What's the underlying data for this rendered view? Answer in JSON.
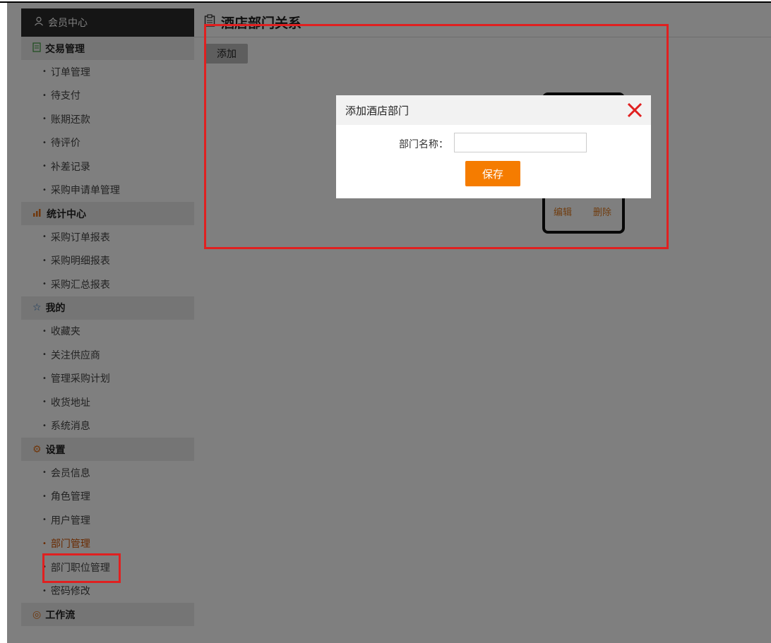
{
  "sidebar": {
    "header": "会员中心",
    "groups": [
      {
        "title": "交易管理",
        "items": [
          "订单管理",
          "待支付",
          "账期还款",
          "待评价",
          "补差记录",
          "采购申请单管理"
        ]
      },
      {
        "title": "统计中心",
        "items": [
          "采购订单报表",
          "采购明细报表",
          "采购汇总报表"
        ]
      },
      {
        "title": "我的",
        "items": [
          "收藏夹",
          "关注供应商",
          "管理采购计划",
          "收货地址",
          "系统消息"
        ]
      },
      {
        "title": "设置",
        "items": [
          "会员信息",
          "角色管理",
          "用户管理",
          "部门管理",
          "部门职位管理",
          "密码修改"
        ]
      },
      {
        "title": "工作流",
        "items": []
      }
    ],
    "active_item": "部门管理"
  },
  "main": {
    "title": "酒店部门关系",
    "add_button": "添加",
    "card_actions": {
      "edit": "编辑",
      "delete": "删除"
    }
  },
  "modal": {
    "title": "添加酒店部门",
    "field_label": "部门名称：",
    "field_value": "",
    "save_button": "保存"
  },
  "colors": {
    "accent": "#f57c00",
    "highlight_box": "#e02020",
    "sidebar_header": "#2a2a2a"
  },
  "icons": {
    "header": "user-icon",
    "group1": "document-icon",
    "group2": "chart-icon",
    "group3": "star-icon",
    "group4": "gear-icon",
    "group5": "workflow-icon",
    "title": "clipboard-icon",
    "close": "close-icon"
  }
}
